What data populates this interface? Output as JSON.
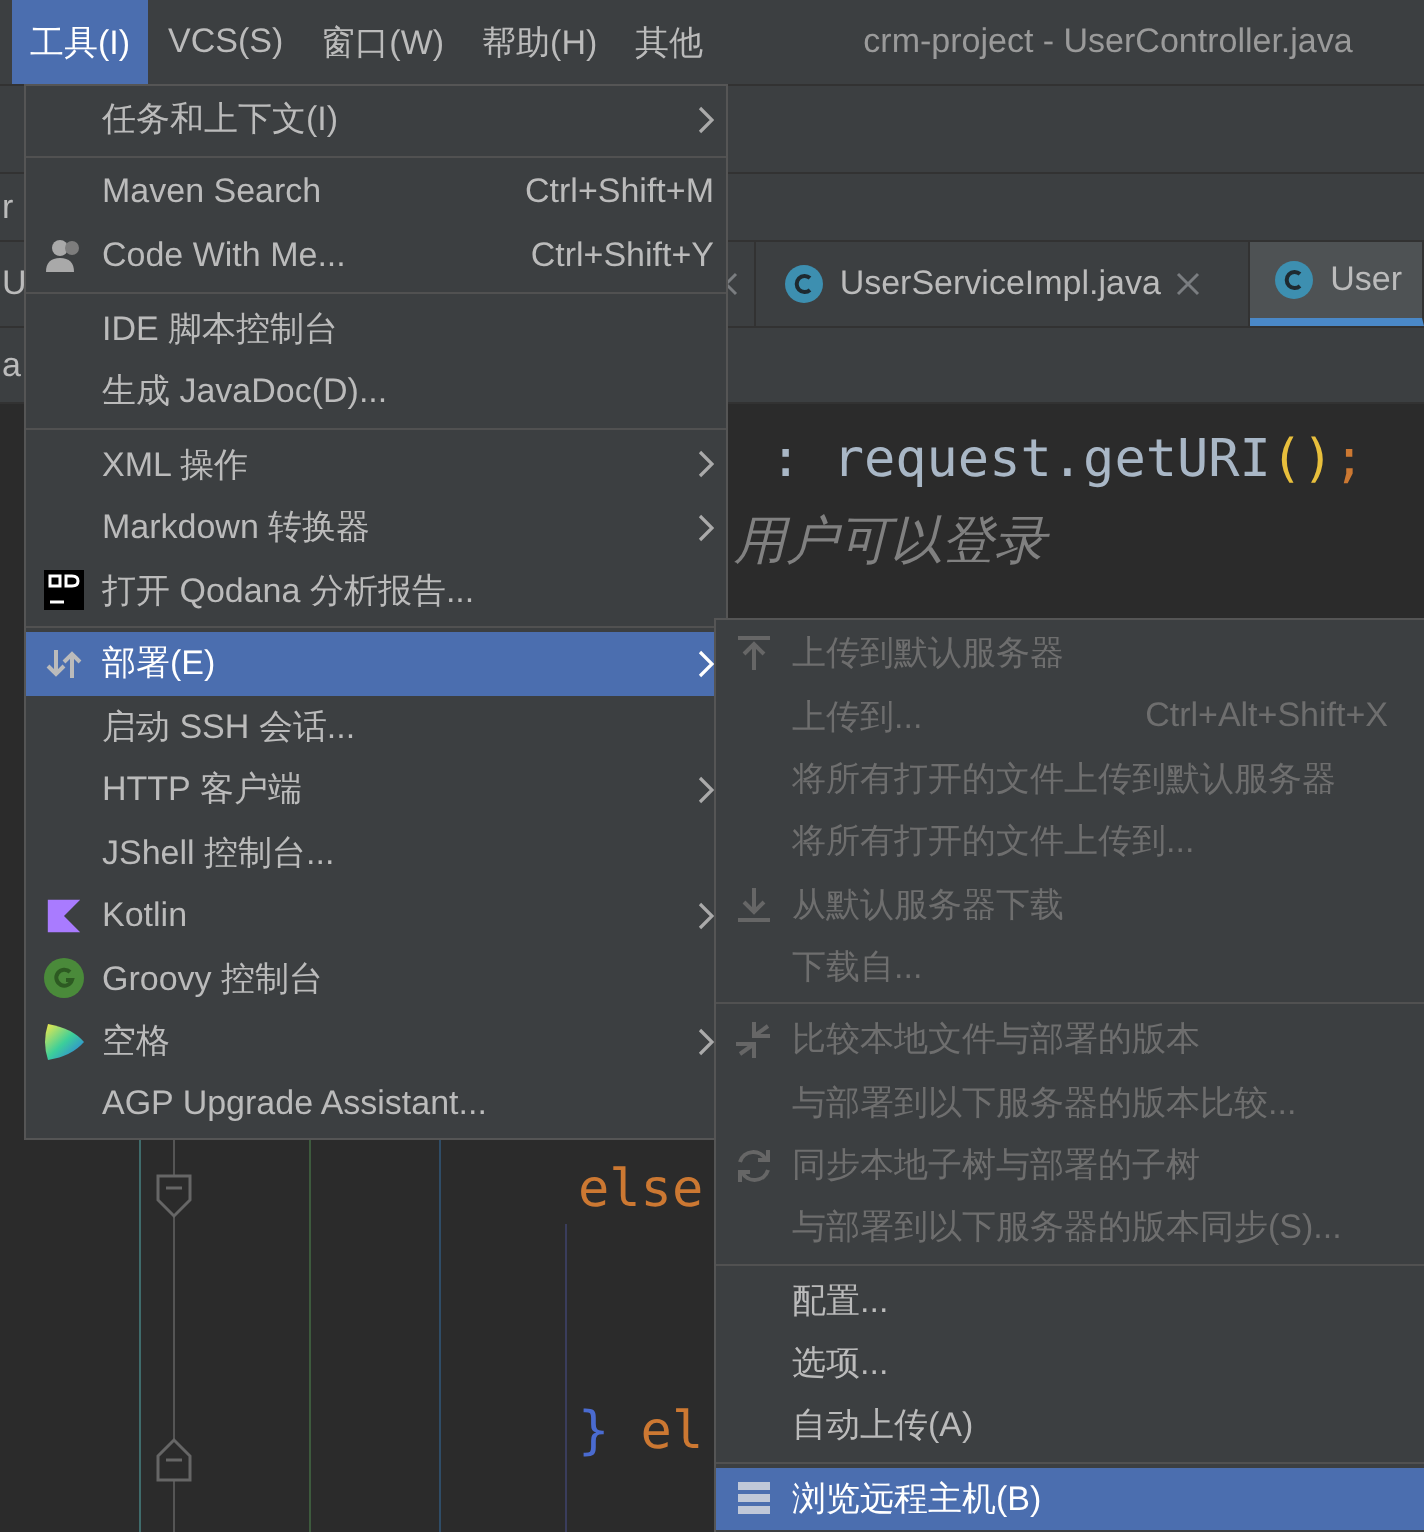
{
  "menubar": {
    "items": [
      {
        "label": "工具(I)",
        "selected": true
      },
      {
        "label": "VCS(S)",
        "selected": false
      },
      {
        "label": "窗口(W)",
        "selected": false
      },
      {
        "label": "帮助(H)",
        "selected": false
      },
      {
        "label": "其他",
        "selected": false
      }
    ],
    "window_title": "crm-project - UserController.java"
  },
  "navigation_bar": {
    "fragment": "r"
  },
  "editor_tabs": [
    {
      "label": "U",
      "selected": false
    },
    {
      "label": "UserServiceImpl.java",
      "selected": false
    },
    {
      "label": "User",
      "selected": true
    }
  ],
  "breadcrumb": {
    "fragment": "a"
  },
  "code_lines": [
    {
      "segments": [
        {
          "text": ": ",
          "kind": "plain"
        },
        {
          "text": "request.getURI",
          "kind": "plain"
        },
        {
          "text": "()",
          "kind": "paren"
        },
        {
          "text": ";",
          "kind": "punct"
        }
      ]
    },
    {
      "segments": [
        {
          "text": "用户可以登录",
          "kind": "comment"
        }
      ]
    },
    {
      "segments": [
        {
          "text": "else",
          "kind": "keyword"
        }
      ]
    },
    {
      "segments": [
        {
          "text": "}",
          "kind": "brace"
        },
        {
          "text": " el",
          "kind": "keyword"
        }
      ]
    }
  ],
  "tools_menu": {
    "groups": [
      {
        "items": [
          {
            "label": "任务和上下文(I)",
            "has_submenu": true,
            "selected": false
          }
        ]
      },
      {
        "items": [
          {
            "label": "Maven Search",
            "shortcut": "Ctrl+Shift+M",
            "has_submenu": false,
            "selected": false
          },
          {
            "label": "Code With Me...",
            "shortcut": "Ctrl+Shift+Y",
            "has_submenu": false,
            "selected": false
          }
        ]
      },
      {
        "items": [
          {
            "label": "IDE 脚本控制台",
            "has_submenu": false,
            "selected": false
          },
          {
            "label": "生成 JavaDoc(D)...",
            "has_submenu": false,
            "selected": false
          }
        ]
      },
      {
        "items": [
          {
            "label": "XML 操作",
            "has_submenu": true,
            "selected": false
          },
          {
            "label": "Markdown 转换器",
            "has_submenu": true,
            "selected": false
          },
          {
            "label": "打开 Qodana 分析报告...",
            "has_submenu": false,
            "selected": false
          }
        ]
      },
      {
        "items": [
          {
            "label": "部署(E)",
            "has_submenu": true,
            "selected": true
          },
          {
            "label": "启动 SSH 会话...",
            "has_submenu": false,
            "selected": false
          },
          {
            "label": "HTTP 客户端",
            "has_submenu": true,
            "selected": false
          },
          {
            "label": "JShell 控制台...",
            "has_submenu": false,
            "selected": false
          },
          {
            "label": "Kotlin",
            "has_submenu": true,
            "selected": false
          },
          {
            "label": "Groovy 控制台",
            "has_submenu": false,
            "selected": false
          },
          {
            "label": "空格",
            "has_submenu": true,
            "selected": false
          },
          {
            "label": "AGP Upgrade Assistant...",
            "has_submenu": false,
            "selected": false
          }
        ]
      }
    ]
  },
  "deployment_submenu": {
    "groups": [
      {
        "items": [
          {
            "label": "上传到默认服务器",
            "disabled": true,
            "selected": false
          },
          {
            "label": "上传到...",
            "shortcut": "Ctrl+Alt+Shift+X",
            "disabled": true,
            "selected": false
          },
          {
            "label": "将所有打开的文件上传到默认服务器",
            "disabled": true,
            "selected": false
          },
          {
            "label": "将所有打开的文件上传到...",
            "disabled": true,
            "selected": false
          },
          {
            "label": "从默认服务器下载",
            "disabled": true,
            "selected": false
          },
          {
            "label": "下载自...",
            "disabled": true,
            "selected": false
          }
        ]
      },
      {
        "items": [
          {
            "label": "比较本地文件与部署的版本",
            "disabled": true,
            "selected": false
          },
          {
            "label": "与部署到以下服务器的版本比较...",
            "disabled": true,
            "selected": false
          },
          {
            "label": "同步本地子树与部署的子树",
            "disabled": true,
            "selected": false
          },
          {
            "label": "与部署到以下服务器的版本同步(S)...",
            "disabled": true,
            "selected": false
          }
        ]
      },
      {
        "items": [
          {
            "label": "配置...",
            "disabled": false,
            "selected": false
          },
          {
            "label": "选项...",
            "disabled": false,
            "selected": false
          },
          {
            "label": "自动上传(A)",
            "disabled": false,
            "selected": false
          }
        ]
      },
      {
        "items": [
          {
            "label": "浏览远程主机(B)",
            "disabled": false,
            "selected": true
          }
        ]
      }
    ]
  }
}
